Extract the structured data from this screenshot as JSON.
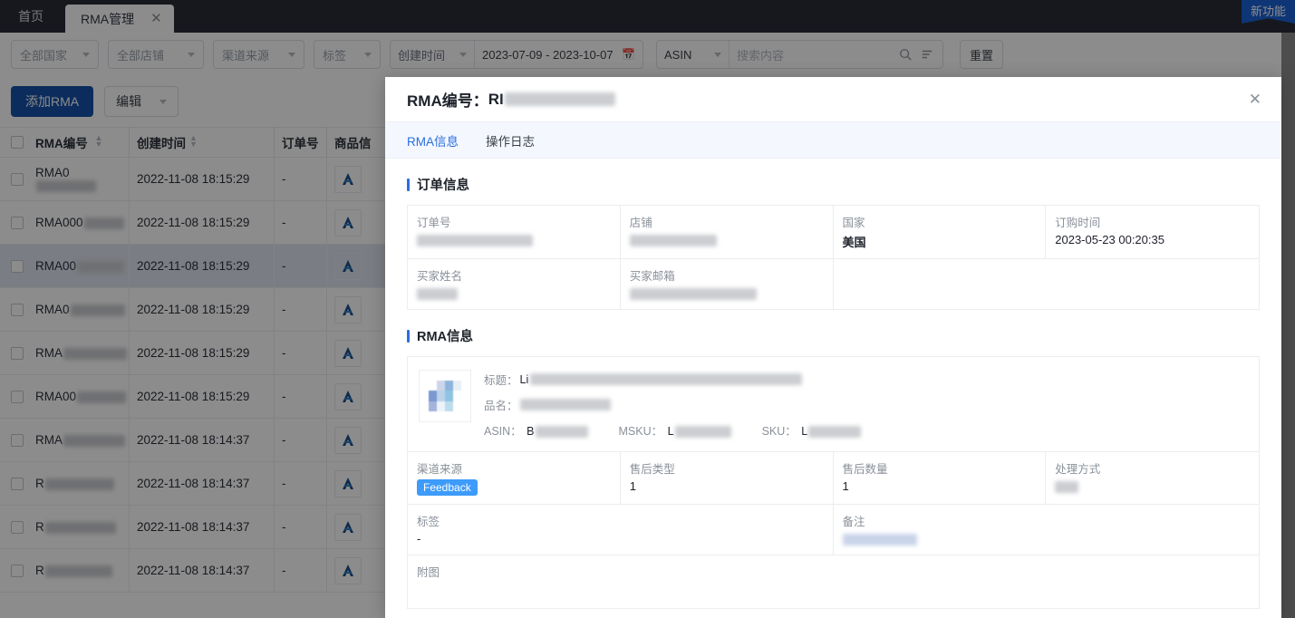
{
  "topbar": {
    "home_label": "首页",
    "active_tab_label": "RMA管理",
    "close_icon": "close-icon",
    "new_feature_label": "新功能"
  },
  "filters": {
    "country": "全部国家",
    "store": "全部店铺",
    "channel": "渠道来源",
    "tag": "标签",
    "date_type": "创建时间",
    "date_range": "2023-07-09 - 2023-10-07",
    "calendar_icon": "calendar-icon",
    "search_type": "ASIN",
    "search_placeholder": "搜索内容",
    "search_icon": "search-icon",
    "filter_icon": "filter-icon",
    "reset_label": "重置"
  },
  "actions": {
    "add_rma_label": "添加RMA",
    "edit_label": "编辑"
  },
  "table": {
    "columns": [
      {
        "key": "rma",
        "label": "RMA编号",
        "sortable": true
      },
      {
        "key": "created",
        "label": "创建时间",
        "sortable": true
      },
      {
        "key": "order",
        "label": "订单号",
        "sortable": false
      },
      {
        "key": "goods",
        "label": "商品信",
        "sortable": false
      }
    ],
    "rows": [
      {
        "rma": "RMA0",
        "rma_blur_w": 66,
        "created": "2022-11-08 18:15:29",
        "order": "-",
        "goods_icon": "amazon-logo-icon",
        "selected": false
      },
      {
        "rma": "RMA000",
        "rma_blur_w": 44,
        "created": "2022-11-08 18:15:29",
        "order": "-",
        "goods_icon": "amazon-logo-icon",
        "selected": false
      },
      {
        "rma": "RMA00",
        "rma_blur_w": 52,
        "created": "2022-11-08 18:15:29",
        "order": "-",
        "goods_icon": "amazon-logo-icon",
        "selected": true
      },
      {
        "rma": "RMA0",
        "rma_blur_w": 60,
        "created": "2022-11-08 18:15:29",
        "order": "-",
        "goods_icon": "amazon-logo-icon",
        "selected": false
      },
      {
        "rma": "RMA",
        "rma_blur_w": 70,
        "created": "2022-11-08 18:15:29",
        "order": "-",
        "goods_icon": "amazon-logo-icon",
        "selected": false
      },
      {
        "rma": "RMA00",
        "rma_blur_w": 54,
        "created": "2022-11-08 18:15:29",
        "order": "-",
        "goods_icon": "amazon-logo-icon",
        "selected": false
      },
      {
        "rma": "RMA",
        "rma_blur_w": 68,
        "created": "2022-11-08 18:14:37",
        "order": "-",
        "goods_icon": "amazon-logo-icon",
        "selected": false
      },
      {
        "rma": "R",
        "rma_blur_w": 76,
        "created": "2022-11-08 18:14:37",
        "order": "-",
        "goods_icon": "amazon-logo-icon",
        "selected": false
      },
      {
        "rma": "R",
        "rma_blur_w": 78,
        "created": "2022-11-08 18:14:37",
        "order": "-",
        "goods_icon": "amazon-logo-icon",
        "selected": false
      },
      {
        "rma": "R",
        "rma_blur_w": 74,
        "created": "2022-11-08 18:14:37",
        "order": "-",
        "goods_icon": "amazon-logo-icon",
        "selected": false
      }
    ]
  },
  "modal": {
    "title_prefix": "RMA编号：",
    "title_value": "RI",
    "close_icon": "close-icon",
    "tabs": [
      {
        "label": "RMA信息",
        "active": true
      },
      {
        "label": "操作日志",
        "active": false
      }
    ],
    "order_section": {
      "title": "订单信息",
      "fields": [
        {
          "label": "订单号",
          "value": "",
          "blurred": true
        },
        {
          "label": "店铺",
          "value": "",
          "blurred": true
        },
        {
          "label": "国家",
          "value": "美国",
          "blurred": false
        },
        {
          "label": "订购时间",
          "value": "2023-05-23 00:20:35",
          "blurred": false
        },
        {
          "label": "买家姓名",
          "value": "",
          "blurred": true
        },
        {
          "label": "买家邮箱",
          "value": "",
          "blurred": true
        }
      ]
    },
    "rma_section": {
      "title": "RMA信息",
      "product": {
        "thumb_icon": "product-thumbnail",
        "title_label": "标题：",
        "title_value": "Li",
        "name_label": "品名：",
        "name_value": "",
        "asin_label": "ASIN：",
        "asin_value": "B",
        "msku_label": "MSKU：",
        "msku_value": "L",
        "sku_label": "SKU：",
        "sku_value": "L"
      },
      "fields": [
        {
          "label": "渠道来源",
          "value": "Feedback",
          "type": "badge"
        },
        {
          "label": "售后类型",
          "value": "1",
          "type": "text"
        },
        {
          "label": "售后数量",
          "value": "1",
          "type": "text"
        },
        {
          "label": "处理方式",
          "value": "",
          "type": "blur"
        },
        {
          "label": "标签",
          "value": "-",
          "type": "text"
        },
        {
          "label": "备注",
          "value": "",
          "type": "blur"
        },
        {
          "label": "附图",
          "value": "",
          "type": "empty"
        }
      ]
    }
  },
  "colors": {
    "primary": "#1451a8",
    "link": "#2a6fe0",
    "badge_feedback": "#3d9bfb",
    "topbar": "#282d38"
  }
}
